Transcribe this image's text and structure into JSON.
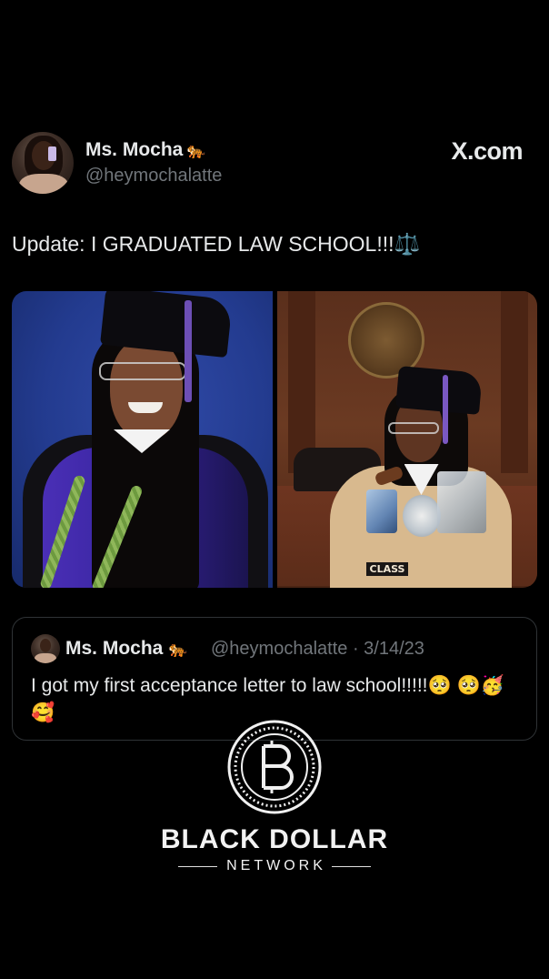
{
  "tweet": {
    "author": {
      "display_name": "Ms. Mocha",
      "name_emoji": "🐅",
      "handle": "@heymochalatte"
    },
    "brand": "X.com",
    "text": "Update: I GRADUATED LAW SCHOOL!!!⚖️",
    "photos": [
      {
        "name": "graduation-portrait"
      },
      {
        "name": "courtroom-portrait",
        "stole_text": "CLASS"
      }
    ]
  },
  "quoted_tweet": {
    "display_name": "Ms. Mocha",
    "name_emoji": "🐅",
    "meta": "@heymochalatte · 3/14/23",
    "text": "I got my first acceptance letter to law school!!!!!🥺 🥺🥳🥰"
  },
  "watermark": {
    "title": "BLACK DOLLAR",
    "subtitle": "NETWORK",
    "logo_icon": "coin-b-icon"
  },
  "colors": {
    "background": "#000000",
    "primary_text": "#e7e9ea",
    "secondary_text": "#71767b",
    "border": "#2f3336"
  }
}
